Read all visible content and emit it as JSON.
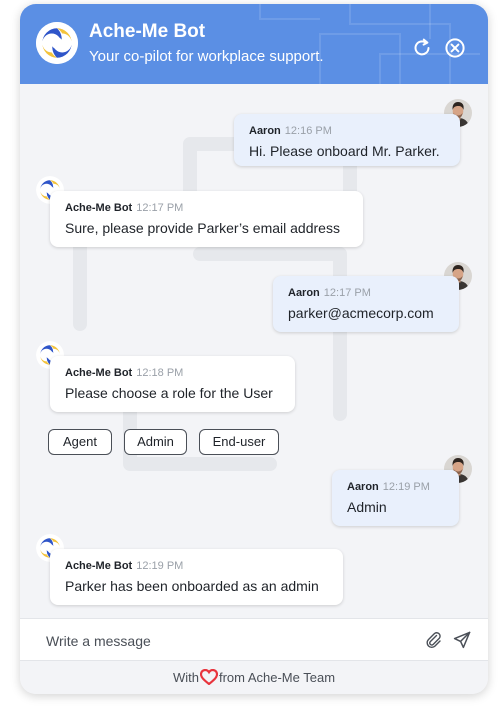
{
  "header": {
    "title": "Ache-Me Bot",
    "subtitle": "Your co-pilot for workplace support.",
    "refresh_icon": "refresh-icon",
    "close_icon": "close-circle-icon"
  },
  "messages": [
    {
      "sender": "Aaron",
      "time": "12:16 PM",
      "text": "Hi. Please onboard Mr. Parker.",
      "side": "user"
    },
    {
      "sender": "Ache-Me Bot",
      "time": "12:17 PM",
      "text": "Sure, please provide Parker’s email address",
      "side": "bot"
    },
    {
      "sender": "Aaron",
      "time": "12:17 PM",
      "text": "parker@acmecorp.com",
      "side": "user"
    },
    {
      "sender": "Ache-Me Bot",
      "time": "12:18 PM",
      "text": "Please choose a role for the User",
      "side": "bot"
    },
    {
      "sender": "Aaron",
      "time": "12:19 PM",
      "text": "Admin",
      "side": "user"
    },
    {
      "sender": "Ache-Me Bot",
      "time": "12:19 PM",
      "text": "Parker has been onboarded as an admin",
      "side": "bot"
    }
  ],
  "role_options": [
    "Agent",
    "Admin",
    "End-user"
  ],
  "composer": {
    "placeholder": "Write a message",
    "attach_icon": "paperclip-icon",
    "send_icon": "send-icon"
  },
  "footer": {
    "prefix": "With",
    "heart_icon": "heart-icon",
    "suffix": "from Ache-Me Team"
  },
  "colors": {
    "header": "#5b8fe4",
    "user_bubble": "#e9f0fc",
    "bot_bubble": "#ffffff",
    "heart": "#e8343d",
    "logo_blue": "#2f55c9",
    "logo_yellow": "#f3c33c"
  }
}
